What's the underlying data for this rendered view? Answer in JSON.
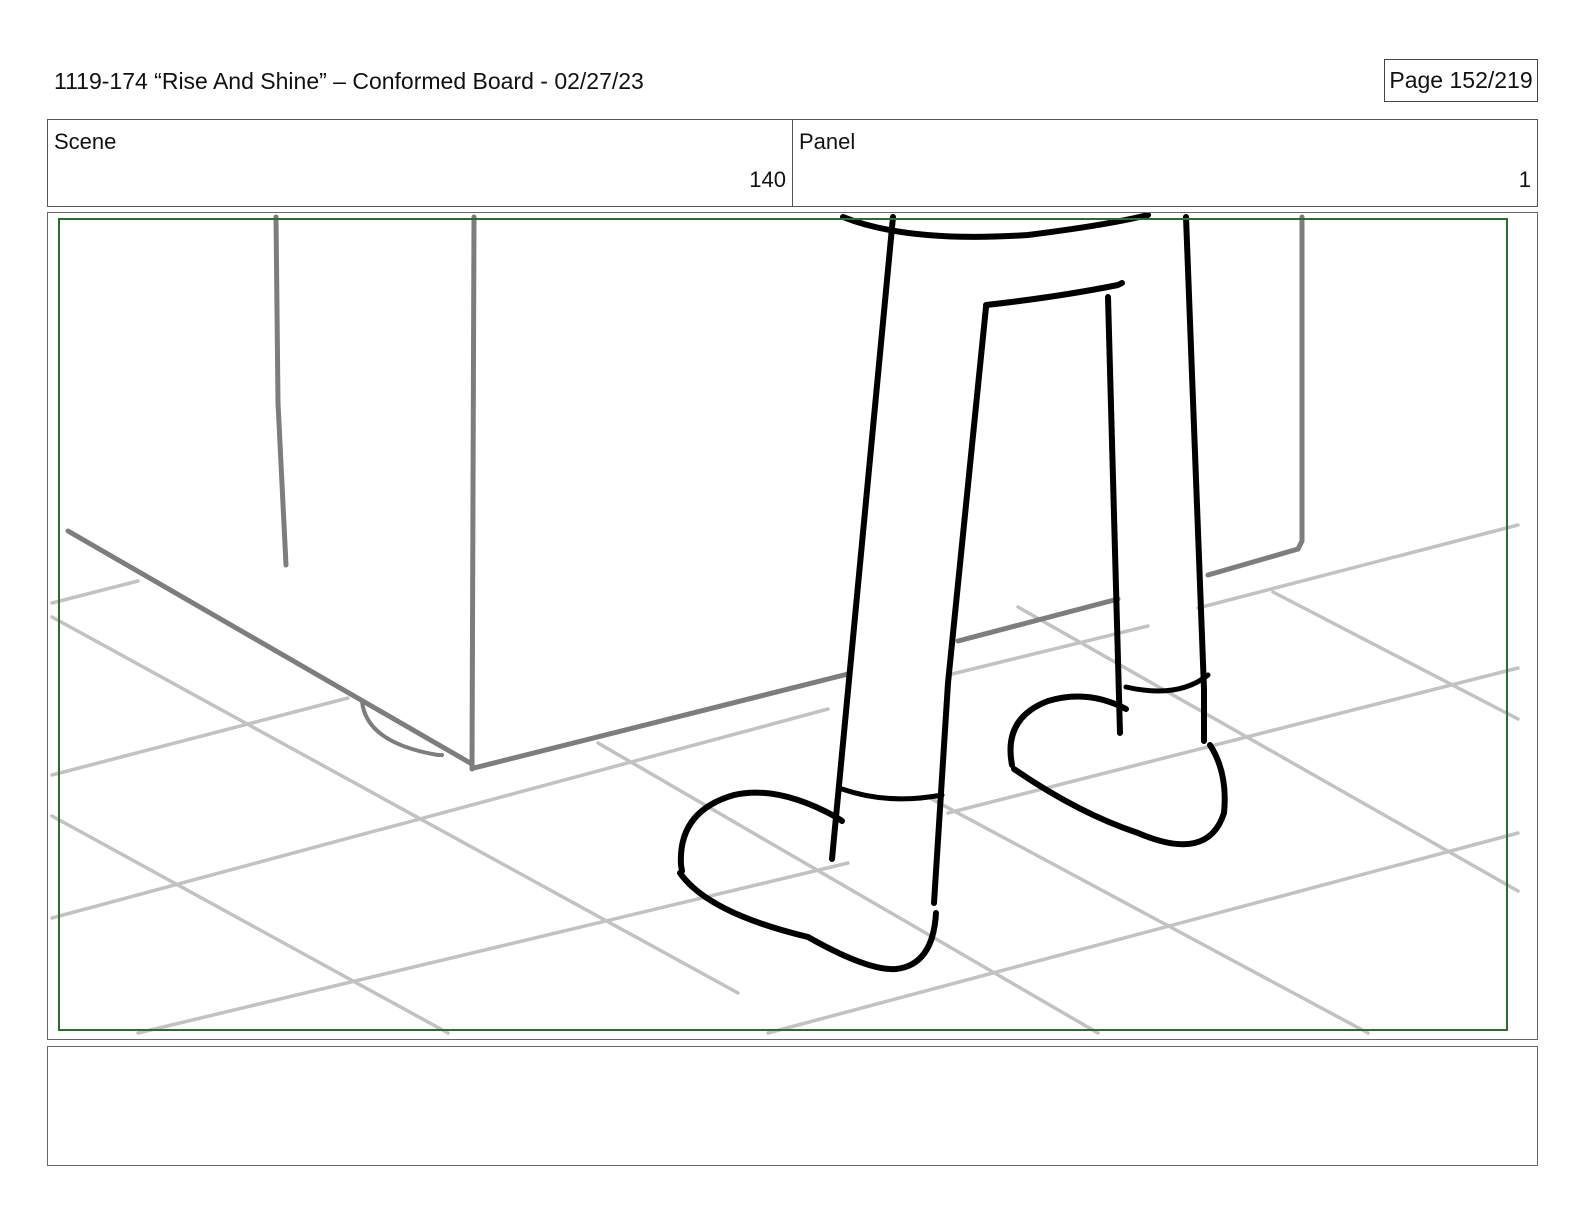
{
  "header": {
    "title": "1119-174 “Rise And Shine” – Conformed Board - 02/27/23",
    "page": "Page 152/219"
  },
  "info": {
    "scene_label": "Scene",
    "scene_value": "140",
    "panel_label": "Panel",
    "panel_value": "1"
  },
  "notes": {
    "text": ""
  },
  "colors": {
    "safe_frame": "#2e6b2e",
    "floor_lines": "#c2c2c2",
    "cabinet_lines": "#7d7d7d",
    "character_lines": "#000000"
  }
}
